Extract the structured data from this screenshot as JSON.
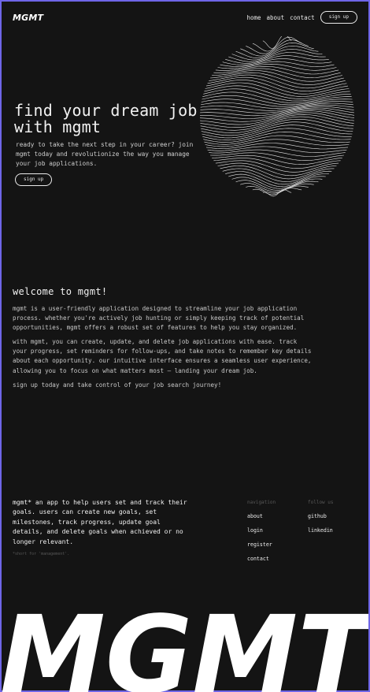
{
  "nav": {
    "brand": "MGMT",
    "links": [
      "home",
      "about",
      "contact"
    ],
    "signup": "sign up"
  },
  "hero": {
    "title": "find your dream job with mgmt",
    "subtitle": "ready to take the next step in your career? join mgmt today and revolutionize the way you manage your job applications.",
    "signup": "sign up"
  },
  "welcome": {
    "title": "welcome to mgmt!",
    "p1": "mgmt is a user-friendly application designed to streamline your job application process. whether you're actively job hunting or simply  keeping track of potential opportunities, mgmt offers a robust set of  features to help you stay organized.",
    "p2": "with mgmt, you can create, update, and delete job applications with  ease. track your progress, set reminders for follow-ups, and take notes  to remember key details about each opportunity. our intuitive interface ensures a seamless user experience, allowing you to focus on what  matters most – landing your dream job.",
    "p3": "sign up today and take control of your job search journey!"
  },
  "footer": {
    "about": "mgmt* an app to help users set and track their goals. users can create new  goals, set milestones, track progress, update goal details, and delete  goals when achieved or no longer relevant.",
    "note": "*short for 'management'.",
    "navigation": {
      "heading": "navigation",
      "links": [
        "about",
        "login",
        "register",
        "contact"
      ]
    },
    "follow": {
      "heading": "follow us",
      "links": [
        "github",
        "linkedin"
      ]
    },
    "logo": "MGMT"
  },
  "colors": {
    "background": "#141414",
    "text": "#e9e9e9",
    "muted": "#585858",
    "frame": "#6f66e8"
  }
}
